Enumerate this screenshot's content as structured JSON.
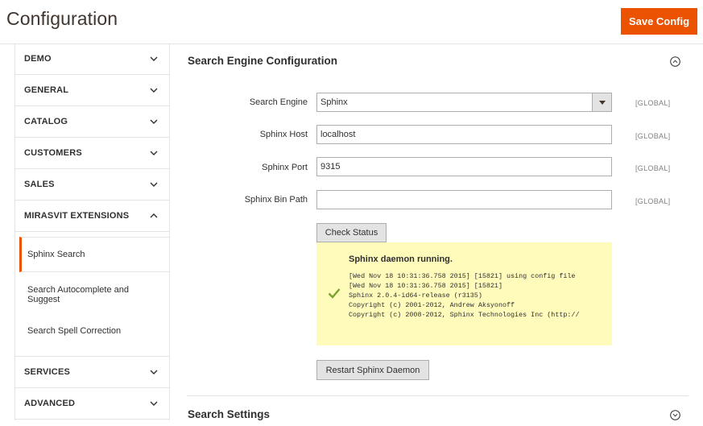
{
  "header": {
    "title": "Configuration",
    "save_label": "Save Config"
  },
  "sidebar": {
    "sections": [
      {
        "label": "DEMO",
        "expanded": false
      },
      {
        "label": "GENERAL",
        "expanded": false
      },
      {
        "label": "CATALOG",
        "expanded": false
      },
      {
        "label": "CUSTOMERS",
        "expanded": false
      },
      {
        "label": "SALES",
        "expanded": false
      },
      {
        "label": "MIRASVIT EXTENSIONS",
        "expanded": true
      },
      {
        "label": "SERVICES",
        "expanded": false
      },
      {
        "label": "ADVANCED",
        "expanded": false
      }
    ],
    "subitems": [
      {
        "label": "Sphinx Search",
        "active": true
      },
      {
        "label": "Search Autocomplete and Suggest",
        "active": false
      },
      {
        "label": "Search Spell Correction",
        "active": false
      }
    ]
  },
  "main": {
    "section_title": "Search Engine Configuration",
    "fields": {
      "engine": {
        "label": "Search Engine",
        "value": "Sphinx",
        "scope": "[GLOBAL]"
      },
      "host": {
        "label": "Sphinx Host",
        "value": "localhost",
        "scope": "[GLOBAL]"
      },
      "port": {
        "label": "Sphinx Port",
        "value": "9315",
        "scope": "[GLOBAL]"
      },
      "bin_path": {
        "label": "Sphinx Bin Path",
        "value": "",
        "scope": "[GLOBAL]"
      }
    },
    "check_status_label": "Check Status",
    "status": {
      "title": "Sphinx daemon running.",
      "log": [
        "[Wed Nov 18 10:31:36.758 2015] [15821] using config file",
        "[Wed Nov 18 10:31:36.758 2015] [15821]",
        "Sphinx 2.0.4-id64-release (r3135)",
        "Copyright (c) 2001-2012, Andrew Aksyonoff",
        "Copyright (c) 2008-2012, Sphinx Technologies Inc (http://"
      ]
    },
    "restart_label": "Restart Sphinx Daemon",
    "next_section_title": "Search Settings"
  },
  "colors": {
    "accent": "#eb5202",
    "status_bg": "#fffbbb",
    "check": "#79a22e"
  }
}
